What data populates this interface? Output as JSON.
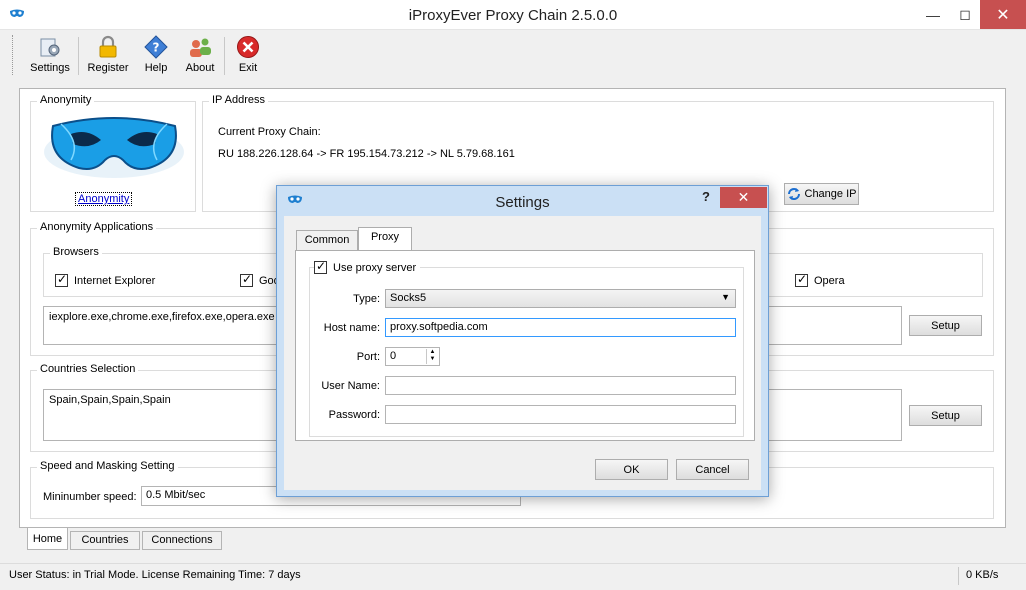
{
  "window": {
    "title": "iProxyEver Proxy Chain 2.5.0.0"
  },
  "toolbar": {
    "settings": "Settings",
    "register": "Register",
    "help": "Help",
    "about": "About",
    "exit": "Exit"
  },
  "anonymity": {
    "group_label": "Anonymity",
    "link": "Anonymity"
  },
  "ip": {
    "group_label": "IP Address",
    "chain_label": "Current Proxy Chain:",
    "chain_value": "RU 188.226.128.64 -> FR 195.154.73.212 -> NL 5.79.68.161",
    "change_ip": "Change IP"
  },
  "apps": {
    "group_label": "Anonymity Applications",
    "browsers_label": "Browsers",
    "ie": "Internet Explorer",
    "chrome_partial": "Goo",
    "opera": "Opera",
    "exe_list": "iexplore.exe,chrome.exe,firefox.exe,opera.exe",
    "setup": "Setup"
  },
  "countries": {
    "group_label": "Countries Selection",
    "value": "Spain,Spain,Spain,Spain",
    "setup": "Setup"
  },
  "speed": {
    "group_label": "Speed and Masking Setting",
    "min_label": "Mininumber speed:",
    "min_value": "0.5 Mbit/sec"
  },
  "bottom_tabs": {
    "home": "Home",
    "countries": "Countries",
    "connections": "Connections"
  },
  "status": {
    "user_status": "User Status:  in Trial Mode. License Remaining Time: 7 days",
    "speed": "0 KB/s"
  },
  "dialog": {
    "title": "Settings",
    "help": "?",
    "tabs": {
      "common": "Common",
      "proxy": "Proxy"
    },
    "use_proxy": "Use proxy server",
    "type_label": "Type:",
    "type_value": "Socks5",
    "host_label": "Host name:",
    "host_value": "proxy.softpedia.com",
    "port_label": "Port:",
    "port_value": "0",
    "user_label": "User Name:",
    "user_value": "",
    "pass_label": "Password:",
    "pass_value": "",
    "ok": "OK",
    "cancel": "Cancel"
  }
}
